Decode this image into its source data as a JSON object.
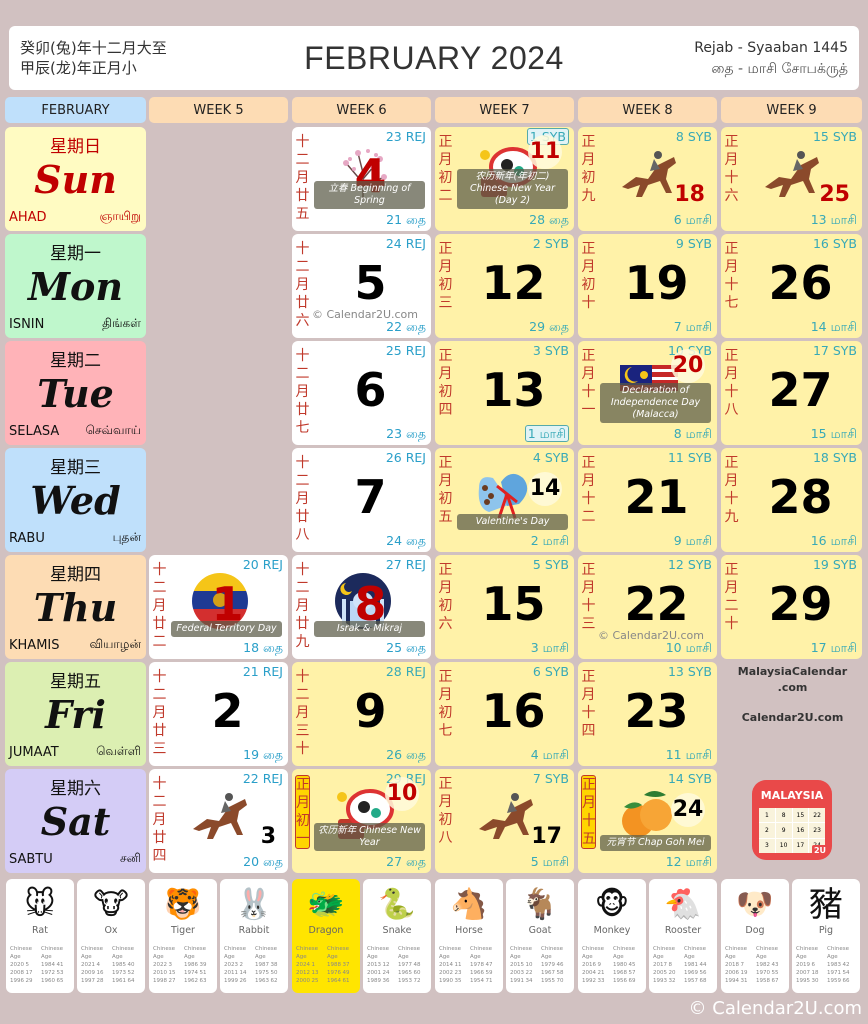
{
  "header": {
    "lunar_line1": "癸卯(兔)年十二月大至",
    "lunar_line2": "甲辰(龙)年正月小",
    "title": "FEBRUARY 2024",
    "hijri": "Rejab - Syaaban 1445",
    "tamil": "தை - மாசி சோபக்ருத்"
  },
  "columns": [
    "FEBRUARY",
    "WEEK 5",
    "WEEK 6",
    "WEEK 7",
    "WEEK 8",
    "WEEK 9"
  ],
  "days": [
    {
      "cn": "星期日",
      "en": "Sun",
      "ms": "AHAD",
      "ta": "ஞாயிறு",
      "color": "#fffbc2",
      "text": "#c00000"
    },
    {
      "cn": "星期一",
      "en": "Mon",
      "ms": "ISNIN",
      "ta": "திங்கள்",
      "color": "#bff7cc",
      "text": "#111111"
    },
    {
      "cn": "星期二",
      "en": "Tue",
      "ms": "SELASA",
      "ta": "செவ்வாய்",
      "color": "#ffb3b8",
      "text": "#111111"
    },
    {
      "cn": "星期三",
      "en": "Wed",
      "ms": "RABU",
      "ta": "புதன்",
      "color": "#bfe0fb",
      "text": "#111111"
    },
    {
      "cn": "星期四",
      "en": "Thu",
      "ms": "KHAMIS",
      "ta": "வியாழன்",
      "color": "#fddcb4",
      "text": "#111111"
    },
    {
      "cn": "星期五",
      "en": "Fri",
      "ms": "JUMAAT",
      "ta": "வெள்ளி",
      "color": "#dcefb2",
      "text": "#111111"
    },
    {
      "cn": "星期六",
      "en": "Sat",
      "ms": "SABTU",
      "ta": "சனி",
      "color": "#d4ccf6",
      "text": "#111111"
    }
  ],
  "cells": [
    {
      "col": 1,
      "row": 4,
      "bg": "white",
      "day": "1",
      "lunar": "十二月廿二",
      "hijri": "20 REJ",
      "tamil": "18 தை",
      "holiday": true,
      "event": "Federal Territory Day",
      "art": "flag-kl"
    },
    {
      "col": 1,
      "row": 5,
      "bg": "white",
      "day": "2",
      "lunar": "十二月廿三",
      "hijri": "21 REJ",
      "tamil": "19 தை"
    },
    {
      "col": 1,
      "row": 6,
      "bg": "white",
      "day": "3",
      "lunar": "十二月廿四",
      "hijri": "22 REJ",
      "tamil": "20 தை",
      "art": "horse",
      "small": true
    },
    {
      "col": 2,
      "row": 0,
      "bg": "white",
      "day": "4",
      "lunar": "十二月廿五",
      "hijri": "23 REJ",
      "tamil": "21 தை",
      "holiday": true,
      "event": "立春 Beginning of Spring",
      "art": "blossom"
    },
    {
      "col": 2,
      "row": 1,
      "bg": "white",
      "day": "5",
      "lunar": "十二月廿六",
      "hijri": "24 REJ",
      "tamil": "22 தை",
      "watermark": "© Calendar2U.com"
    },
    {
      "col": 2,
      "row": 2,
      "bg": "white",
      "day": "6",
      "lunar": "十二月廿七",
      "hijri": "25 REJ",
      "tamil": "23 தை"
    },
    {
      "col": 2,
      "row": 3,
      "bg": "white",
      "day": "7",
      "lunar": "十二月廿八",
      "hijri": "26 REJ",
      "tamil": "24 தை"
    },
    {
      "col": 2,
      "row": 4,
      "bg": "white",
      "day": "8",
      "lunar": "十二月廿九",
      "hijri": "27 REJ",
      "tamil": "25 தை",
      "holiday": true,
      "event": "Israk & Mikraj",
      "art": "mosque"
    },
    {
      "col": 2,
      "row": 5,
      "bg": "yellow",
      "day": "9",
      "lunar": "十二月三十",
      "hijri": "28 REJ",
      "tamil": "26 தை"
    },
    {
      "col": 2,
      "row": 6,
      "bg": "yellow",
      "day": "10",
      "lunar": "正月初一",
      "lunar_boxed": true,
      "hijri": "29 REJ",
      "tamil": "27 தை",
      "holiday": true,
      "badge": true,
      "event": "农历新年 Chinese New Year",
      "art": "lion"
    },
    {
      "col": 3,
      "row": 0,
      "bg": "yellow",
      "day": "11",
      "lunar": "正月初二",
      "hijri": "1 SYB",
      "hijri_boxed": true,
      "tamil": "28 தை",
      "holiday": true,
      "badge": true,
      "event": "农历新年(年初二) Chinese New Year (Day 2)",
      "art": "lion"
    },
    {
      "col": 3,
      "row": 1,
      "bg": "yellow",
      "day": "12",
      "lunar": "正月初三",
      "hijri": "2 SYB",
      "tamil": "29 தை"
    },
    {
      "col": 3,
      "row": 2,
      "bg": "yellow",
      "day": "13",
      "lunar": "正月初四",
      "hijri": "3 SYB",
      "tamil": "1 மாசி",
      "tamil_boxed": true
    },
    {
      "col": 3,
      "row": 3,
      "bg": "yellow",
      "day": "14",
      "lunar": "正月初五",
      "hijri": "4 SYB",
      "tamil": "2 மாசி",
      "badge": true,
      "badge_black": true,
      "event": "Valentine's Day",
      "art": "chocolate"
    },
    {
      "col": 3,
      "row": 4,
      "bg": "yellow",
      "day": "15",
      "lunar": "正月初六",
      "hijri": "5 SYB",
      "tamil": "3 மாசி"
    },
    {
      "col": 3,
      "row": 5,
      "bg": "yellow",
      "day": "16",
      "lunar": "正月初七",
      "hijri": "6 SYB",
      "tamil": "4 மாசி"
    },
    {
      "col": 3,
      "row": 6,
      "bg": "yellow",
      "day": "17",
      "lunar": "正月初八",
      "hijri": "7 SYB",
      "tamil": "5 மாசி",
      "art": "horse",
      "small": true
    },
    {
      "col": 4,
      "row": 0,
      "bg": "yellow",
      "day": "18",
      "lunar": "正月初九",
      "hijri": "8 SYB",
      "tamil": "6 மாசி",
      "holiday": true,
      "small": true,
      "art": "horse"
    },
    {
      "col": 4,
      "row": 1,
      "bg": "yellow",
      "day": "19",
      "lunar": "正月初十",
      "hijri": "9 SYB",
      "tamil": "7 மாசி"
    },
    {
      "col": 4,
      "row": 2,
      "bg": "yellow",
      "day": "20",
      "lunar": "正月十一",
      "hijri": "10 SYB",
      "tamil": "8 மாசி",
      "holiday": true,
      "badge": true,
      "event": "Declaration of Independence Day (Malacca)",
      "art": "flag-my"
    },
    {
      "col": 4,
      "row": 3,
      "bg": "yellow",
      "day": "21",
      "lunar": "正月十二",
      "hijri": "11 SYB",
      "tamil": "9 மாசி"
    },
    {
      "col": 4,
      "row": 4,
      "bg": "yellow",
      "day": "22",
      "lunar": "正月十三",
      "hijri": "12 SYB",
      "tamil": "10 மாசி",
      "watermark": "© Calendar2U.com"
    },
    {
      "col": 4,
      "row": 5,
      "bg": "yellow",
      "day": "23",
      "lunar": "正月十四",
      "hijri": "13 SYB",
      "tamil": "11 மாசி"
    },
    {
      "col": 4,
      "row": 6,
      "bg": "yellow",
      "day": "24",
      "lunar": "正月十五",
      "lunar_boxed": true,
      "hijri": "14 SYB",
      "tamil": "12 மாசி",
      "badge": true,
      "badge_black": true,
      "event": "元宵节 Chap Goh Mei",
      "art": "orange"
    },
    {
      "col": 5,
      "row": 0,
      "bg": "yellow",
      "day": "25",
      "lunar": "正月十六",
      "hijri": "15 SYB",
      "tamil": "13 மாசி",
      "holiday": true,
      "small": true,
      "art": "horse"
    },
    {
      "col": 5,
      "row": 1,
      "bg": "yellow",
      "day": "26",
      "lunar": "正月十七",
      "hijri": "16 SYB",
      "tamil": "14 மாசி"
    },
    {
      "col": 5,
      "row": 2,
      "bg": "yellow",
      "day": "27",
      "lunar": "正月十八",
      "hijri": "17 SYB",
      "tamil": "15 மாசி"
    },
    {
      "col": 5,
      "row": 3,
      "bg": "yellow",
      "day": "28",
      "lunar": "正月十九",
      "hijri": "18 SYB",
      "tamil": "16 மாசி"
    },
    {
      "col": 5,
      "row": 4,
      "bg": "yellow",
      "day": "29",
      "lunar": "正月二十",
      "hijri": "19 SYB",
      "tamil": "17 மாசி"
    }
  ],
  "brand": {
    "line1": "MalaysiaCalendar",
    "line2": ".com",
    "line3": "Calendar2U.com"
  },
  "app_logo": {
    "title": "MALAYSIA",
    "badge": "2U",
    "grid": [
      "1",
      "8",
      "15",
      "22",
      "2",
      "9",
      "16",
      "23",
      "3",
      "10",
      "17",
      "24"
    ]
  },
  "zodiac_label": "Chinese Age",
  "zodiac": [
    {
      "name": "Rat",
      "icon": "🐭",
      "rows": [
        [
          "2020",
          "5",
          "1984",
          "41"
        ],
        [
          "2008",
          "17",
          "1972",
          "53"
        ],
        [
          "1996",
          "29",
          "1960",
          "65"
        ]
      ]
    },
    {
      "name": "Ox",
      "icon": "🐮",
      "rows": [
        [
          "2021",
          "4",
          "1985",
          "40"
        ],
        [
          "2009",
          "16",
          "1973",
          "52"
        ],
        [
          "1997",
          "28",
          "1961",
          "64"
        ]
      ]
    },
    {
      "name": "Tiger",
      "icon": "🐯",
      "rows": [
        [
          "2022",
          "3",
          "1986",
          "39"
        ],
        [
          "2010",
          "15",
          "1974",
          "51"
        ],
        [
          "1998",
          "27",
          "1962",
          "63"
        ]
      ]
    },
    {
      "name": "Rabbit",
      "icon": "🐰",
      "rows": [
        [
          "2023",
          "2",
          "1987",
          "38"
        ],
        [
          "2011",
          "14",
          "1975",
          "50"
        ],
        [
          "1999",
          "26",
          "1963",
          "62"
        ]
      ]
    },
    {
      "name": "Dragon",
      "icon": "🐲",
      "highlight": true,
      "rows": [
        [
          "2024",
          "1",
          "1988",
          "37"
        ],
        [
          "2012",
          "13",
          "1976",
          "49"
        ],
        [
          "2000",
          "25",
          "1964",
          "61"
        ]
      ]
    },
    {
      "name": "Snake",
      "icon": "🐍",
      "rows": [
        [
          "2013",
          "12",
          "1977",
          "48"
        ],
        [
          "2001",
          "24",
          "1965",
          "60"
        ],
        [
          "1989",
          "36",
          "1953",
          "72"
        ]
      ]
    },
    {
      "name": "Horse",
      "icon": "🐴",
      "rows": [
        [
          "2014",
          "11",
          "1978",
          "47"
        ],
        [
          "2002",
          "23",
          "1966",
          "59"
        ],
        [
          "1990",
          "35",
          "1954",
          "71"
        ]
      ]
    },
    {
      "name": "Goat",
      "icon": "🐐",
      "rows": [
        [
          "2015",
          "10",
          "1979",
          "46"
        ],
        [
          "2003",
          "22",
          "1967",
          "58"
        ],
        [
          "1991",
          "34",
          "1955",
          "70"
        ]
      ]
    },
    {
      "name": "Monkey",
      "icon": "🐵",
      "rows": [
        [
          "2016",
          "9",
          "1980",
          "45"
        ],
        [
          "2004",
          "21",
          "1968",
          "57"
        ],
        [
          "1992",
          "33",
          "1956",
          "69"
        ]
      ]
    },
    {
      "name": "Rooster",
      "icon": "🐔",
      "rows": [
        [
          "2017",
          "8",
          "1981",
          "44"
        ],
        [
          "2005",
          "20",
          "1969",
          "56"
        ],
        [
          "1993",
          "32",
          "1957",
          "68"
        ]
      ]
    },
    {
      "name": "Dog",
      "icon": "🐶",
      "rows": [
        [
          "2018",
          "7",
          "1982",
          "43"
        ],
        [
          "2006",
          "19",
          "1970",
          "55"
        ],
        [
          "1994",
          "31",
          "1958",
          "67"
        ]
      ]
    },
    {
      "name": "Pig",
      "icon": "豬",
      "rows": [
        [
          "2019",
          "6",
          "1983",
          "42"
        ],
        [
          "2007",
          "18",
          "1971",
          "54"
        ],
        [
          "1995",
          "30",
          "1959",
          "66"
        ]
      ]
    }
  ],
  "copyright": "© Calendar2U.com"
}
